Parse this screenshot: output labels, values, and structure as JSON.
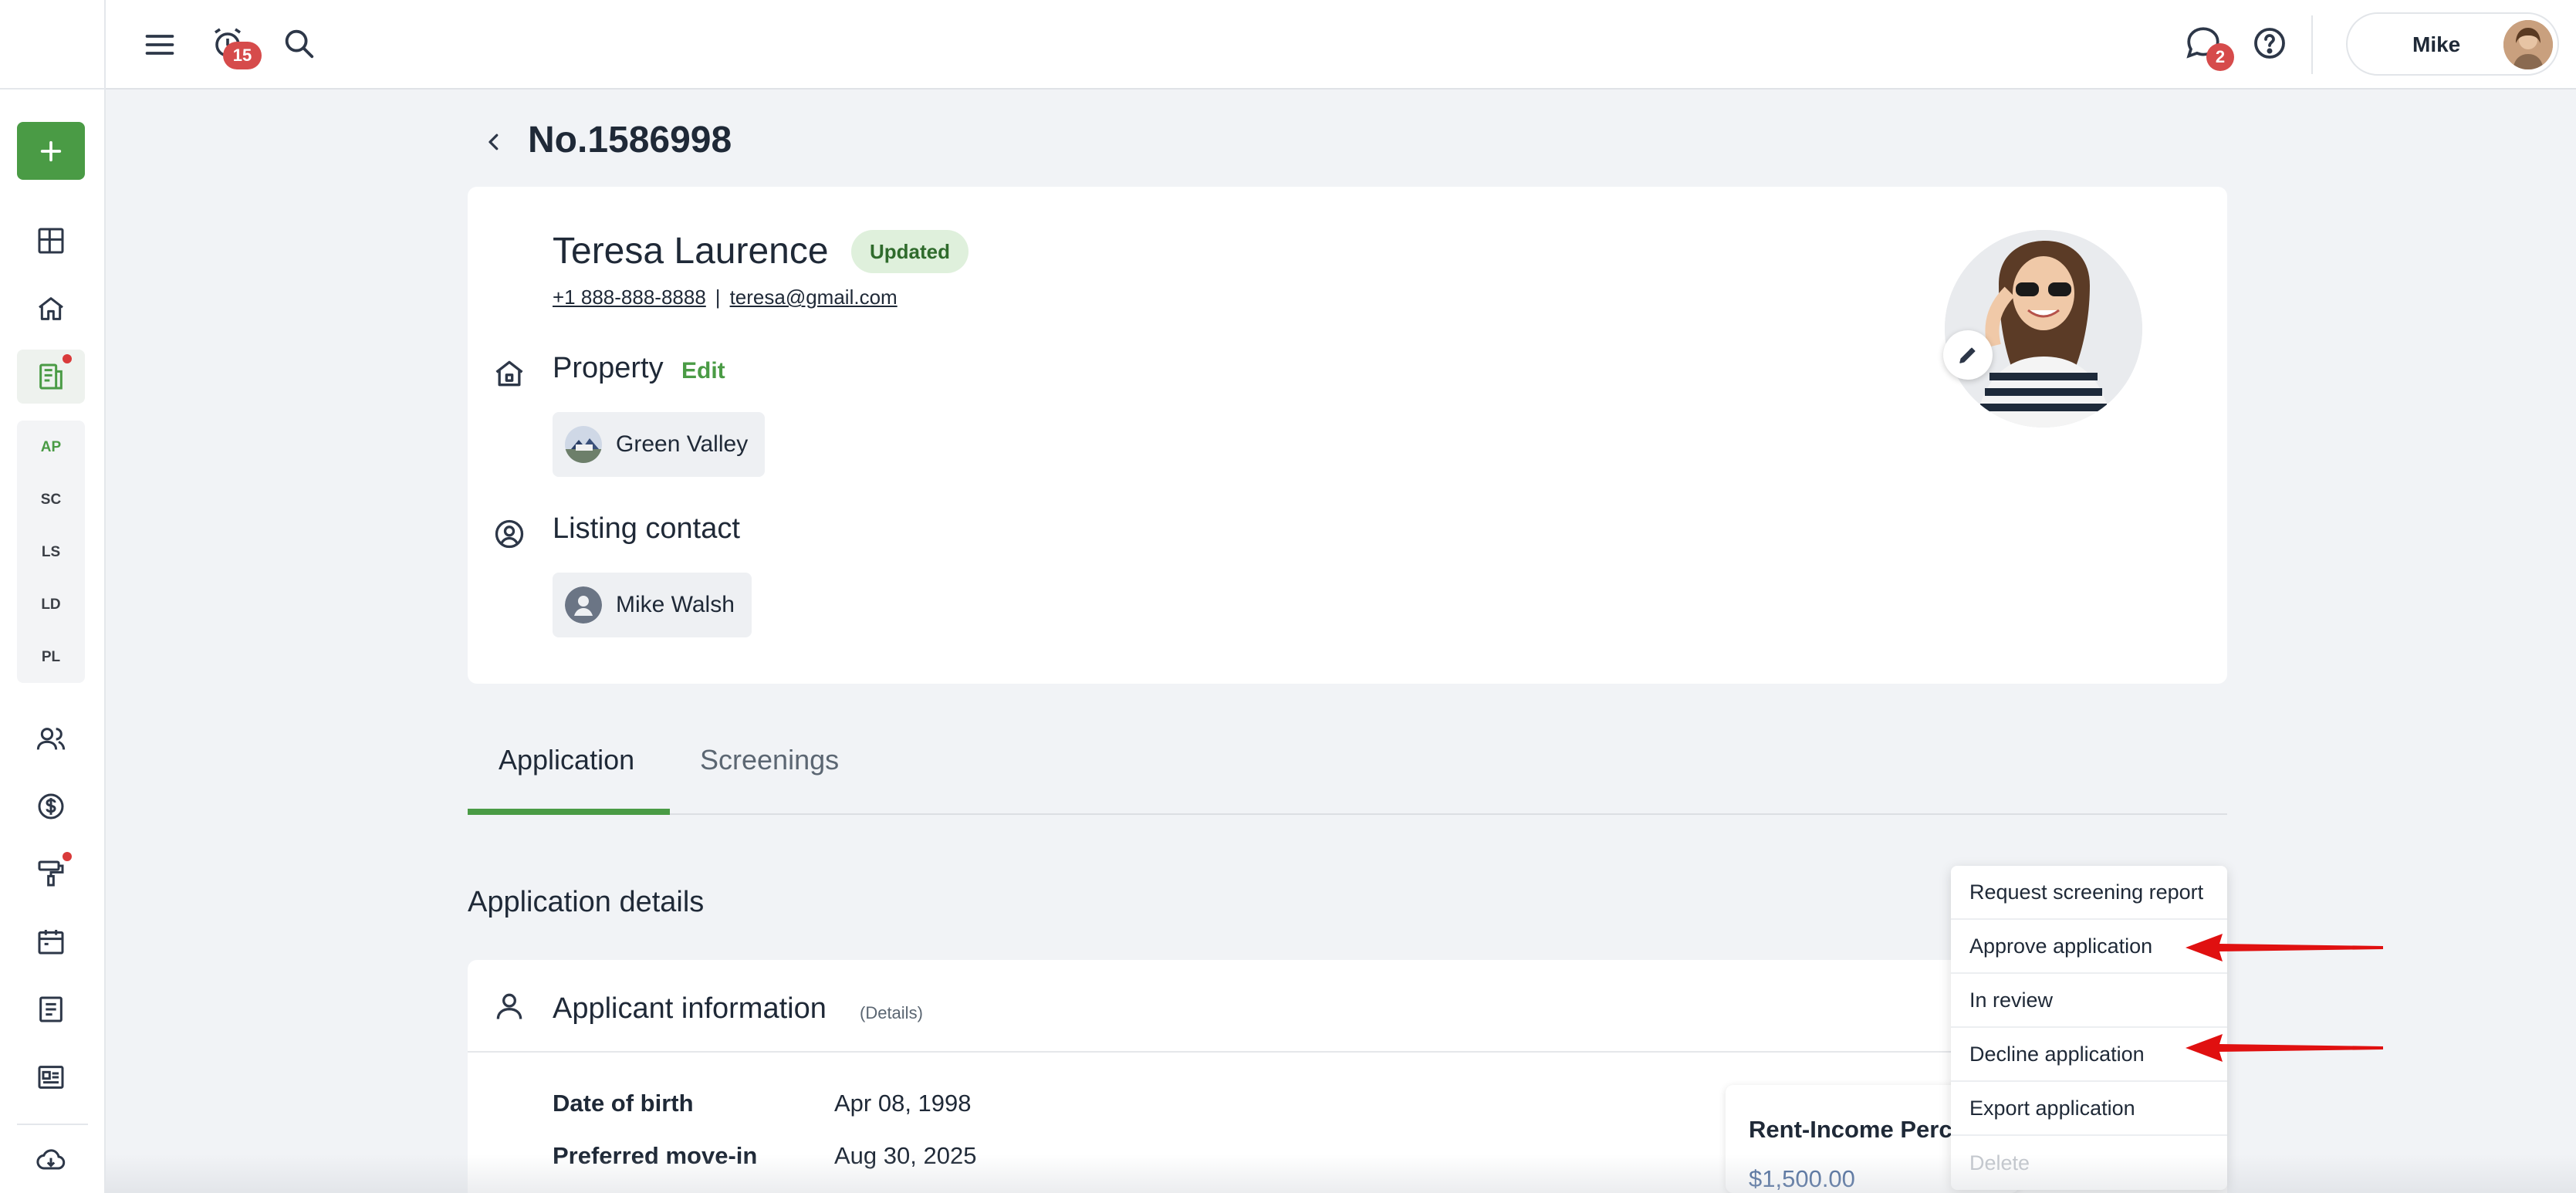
{
  "topbar": {
    "alerts_badge": "15",
    "messages_badge": "2",
    "user_name": "Mike"
  },
  "sidebar": {
    "sub_items": [
      "AP",
      "SC",
      "LS",
      "LD",
      "PL"
    ]
  },
  "page": {
    "title": "No.1586998"
  },
  "applicant": {
    "name": "Teresa Laurence",
    "status": "Updated",
    "phone": "+1 888-888-8888",
    "separator": "|",
    "email": "teresa@gmail.com"
  },
  "property": {
    "label": "Property",
    "edit_label": "Edit",
    "value": "Green Valley"
  },
  "listing_contact": {
    "label": "Listing contact",
    "value": "Mike Walsh"
  },
  "tabs": [
    {
      "label": "Application",
      "active": true
    },
    {
      "label": "Screenings",
      "active": false
    }
  ],
  "details": {
    "heading": "Application details",
    "card_title": "Applicant information",
    "card_hint": "(Details)",
    "fields": [
      {
        "label": "Date of birth",
        "value": "Apr 08, 1998"
      },
      {
        "label": "Preferred move-in",
        "value": "Aug 30, 2025"
      }
    ],
    "rent_income": {
      "title": "Rent-Income Percentage",
      "value": "$1,500.00"
    }
  },
  "menu": {
    "items": [
      {
        "label": "Request screening report",
        "disabled": false
      },
      {
        "label": "Approve application",
        "disabled": false
      },
      {
        "label": "In review",
        "disabled": false
      },
      {
        "label": "Decline application",
        "disabled": false
      },
      {
        "label": "Export application",
        "disabled": false
      },
      {
        "label": "Delete",
        "disabled": true
      }
    ]
  },
  "colors": {
    "accent_green": "#4a9b45",
    "badge_red": "#d64b4b",
    "arrow_red": "#e01010"
  }
}
